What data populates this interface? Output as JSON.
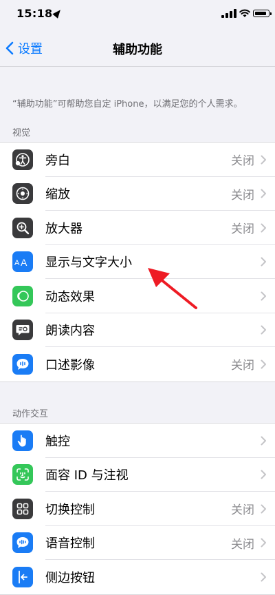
{
  "status": {
    "time": "15:18"
  },
  "nav": {
    "back_label": "设置",
    "title": "辅助功能"
  },
  "intro": "“辅助功能”可帮助您自定 iPhone，以满足您的个人需求。",
  "sections": [
    {
      "header": "视觉",
      "items": [
        {
          "label": "旁白",
          "value": "关闭",
          "icon": "voiceover-icon",
          "color": "#3a3a3c"
        },
        {
          "label": "缩放",
          "value": "关闭",
          "icon": "zoom-icon",
          "color": "#3a3a3c"
        },
        {
          "label": "放大器",
          "value": "关闭",
          "icon": "magnifier-icon",
          "color": "#3a3a3c"
        },
        {
          "label": "显示与文字大小",
          "value": "",
          "icon": "text-size-icon",
          "color": "#1a7cf5"
        },
        {
          "label": "动态效果",
          "value": "",
          "icon": "motion-icon",
          "color": "#34c759"
        },
        {
          "label": "朗读内容",
          "value": "",
          "icon": "spoken-content-icon",
          "color": "#3a3a3c"
        },
        {
          "label": "口述影像",
          "value": "关闭",
          "icon": "audio-description-icon",
          "color": "#1a7cf5"
        }
      ]
    },
    {
      "header": "动作交互",
      "items": [
        {
          "label": "触控",
          "value": "",
          "icon": "touch-icon",
          "color": "#1a7cf5"
        },
        {
          "label": "面容 ID 与注视",
          "value": "",
          "icon": "face-id-icon",
          "color": "#34c759"
        },
        {
          "label": "切换控制",
          "value": "关闭",
          "icon": "switch-control-icon",
          "color": "#3a3a3c"
        },
        {
          "label": "语音控制",
          "value": "关闭",
          "icon": "voice-control-icon",
          "color": "#1a7cf5"
        },
        {
          "label": "侧边按钮",
          "value": "",
          "icon": "side-button-icon",
          "color": "#1a7cf5"
        }
      ]
    }
  ],
  "accent": "#0a7aff",
  "annotation_color": "#ee1b24"
}
